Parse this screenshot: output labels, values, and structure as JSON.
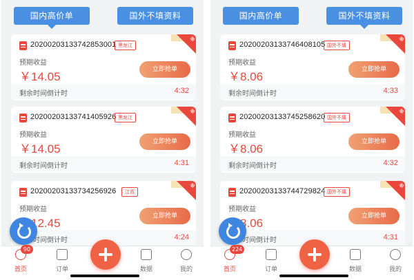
{
  "panels": [
    {
      "tabs": [
        "国内高价单",
        "国外不填资料"
      ],
      "active_tab": 0,
      "orders": [
        {
          "id": "20200203133742853001",
          "region": "黑龙江",
          "income_label": "预期收益",
          "price": "￥14.05",
          "button": "立即抢单",
          "countdown_label": "剩余时间倒计时",
          "countdown": "4:32"
        },
        {
          "id": "20200203133741405926",
          "region": "黑龙江",
          "income_label": "预期收益",
          "price": "￥14.05",
          "button": "立即抢单",
          "countdown_label": "剩余时间倒计时",
          "countdown": "4:31"
        },
        {
          "id": "20200203133734256926",
          "region": "江苏",
          "income_label": "预期收益",
          "price": "￥12.45",
          "button": "立即抢单",
          "countdown_label": "剩余时间倒计时",
          "countdown": "4:24"
        }
      ],
      "nav": {
        "home": "首页",
        "orders": "订单",
        "data": "数据",
        "mine": "我的",
        "badge": "90"
      }
    },
    {
      "tabs": [
        "国内高价单",
        "国外不填资料"
      ],
      "active_tab": 1,
      "orders": [
        {
          "id": "20200203133746408105",
          "region": "国外不填",
          "income_label": "预期收益",
          "price": "￥8.06",
          "button": "立即抢单",
          "countdown_label": "剩余时间倒计时",
          "countdown": "4:33"
        },
        {
          "id": "20200203133745258620",
          "region": "国外不填",
          "income_label": "预期收益",
          "price": "￥8.06",
          "button": "立即抢单",
          "countdown_label": "剩余时间倒计时",
          "countdown": "4:32"
        },
        {
          "id": "20200203133744729824",
          "region": "国外不填",
          "income_label": "预期收益",
          "price": "￥8.06",
          "button": "立即抢单",
          "countdown_label": "剩余时间倒计时",
          "countdown": "4:31"
        }
      ],
      "nav": {
        "home": "首页",
        "orders": "订单",
        "data": "数据",
        "mine": "我的",
        "badge": "224"
      }
    }
  ],
  "ribbon_text": "单",
  "colors": {
    "accent_red": "#e9473c",
    "tab_blue": "#4a90e2",
    "button_orange": "#ec7a55",
    "refresh_blue": "#3f86e0"
  },
  "icons": {
    "order": "doc-icon",
    "refresh": "refresh-icon",
    "home": "home-icon",
    "orders_tab": "clipboard-icon",
    "data_tab": "chart-icon",
    "mine_tab": "person-icon",
    "publish": "plus-icon"
  }
}
